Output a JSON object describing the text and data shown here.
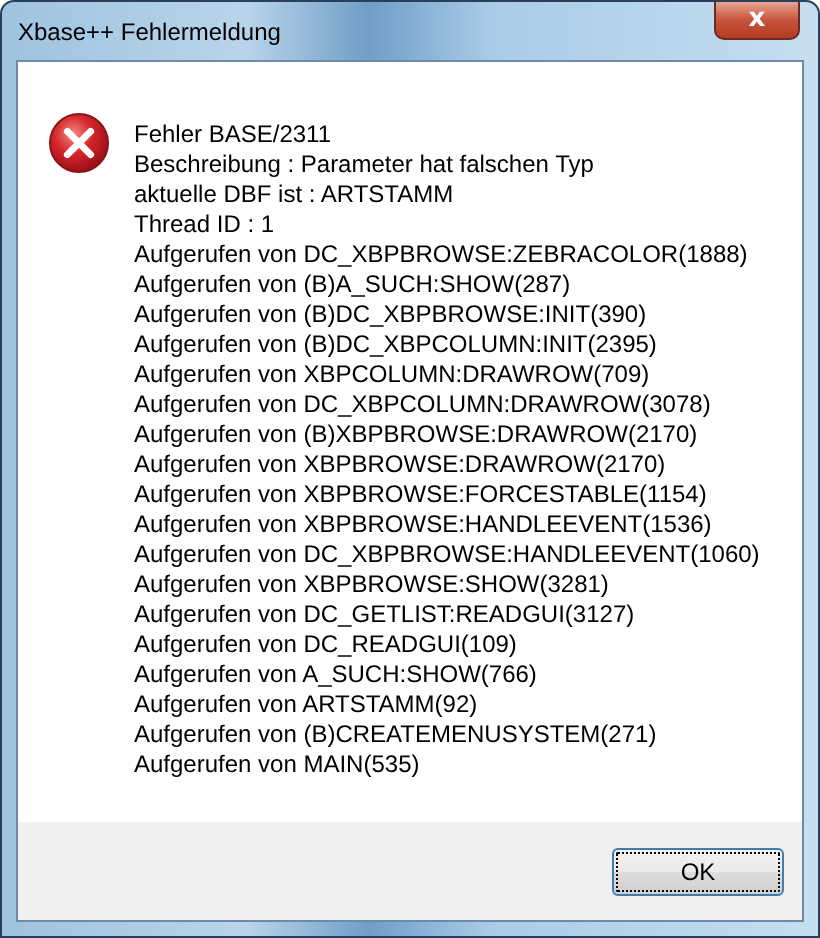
{
  "window": {
    "title": "Xbase++ Fehlermeldung",
    "close_button": "x"
  },
  "message": {
    "lines": [
      "Fehler BASE/2311",
      "Beschreibung : Parameter hat falschen Typ",
      "aktuelle DBF ist : ARTSTAMM",
      "Thread ID : 1",
      "Aufgerufen von DC_XBPBROWSE:ZEBRACOLOR(1888)",
      "Aufgerufen von (B)A_SUCH:SHOW(287)",
      "Aufgerufen von (B)DC_XBPBROWSE:INIT(390)",
      "Aufgerufen von (B)DC_XBPCOLUMN:INIT(2395)",
      "Aufgerufen von XBPCOLUMN:DRAWROW(709)",
      "Aufgerufen von DC_XBPCOLUMN:DRAWROW(3078)",
      "Aufgerufen von (B)XBPBROWSE:DRAWROW(2170)",
      "Aufgerufen von XBPBROWSE:DRAWROW(2170)",
      "Aufgerufen von XBPBROWSE:FORCESTABLE(1154)",
      "Aufgerufen von XBPBROWSE:HANDLEEVENT(1536)",
      "Aufgerufen von DC_XBPBROWSE:HANDLEEVENT(1060)",
      "Aufgerufen von XBPBROWSE:SHOW(3281)",
      "Aufgerufen von DC_GETLIST:READGUI(3127)",
      "Aufgerufen von DC_READGUI(109)",
      "Aufgerufen von A_SUCH:SHOW(766)",
      "Aufgerufen von ARTSTAMM(92)",
      "Aufgerufen von (B)CREATEMENUSYSTEM(271)",
      "Aufgerufen von MAIN(535)"
    ]
  },
  "buttons": [
    {
      "label": "OK",
      "focused": true
    }
  ]
}
